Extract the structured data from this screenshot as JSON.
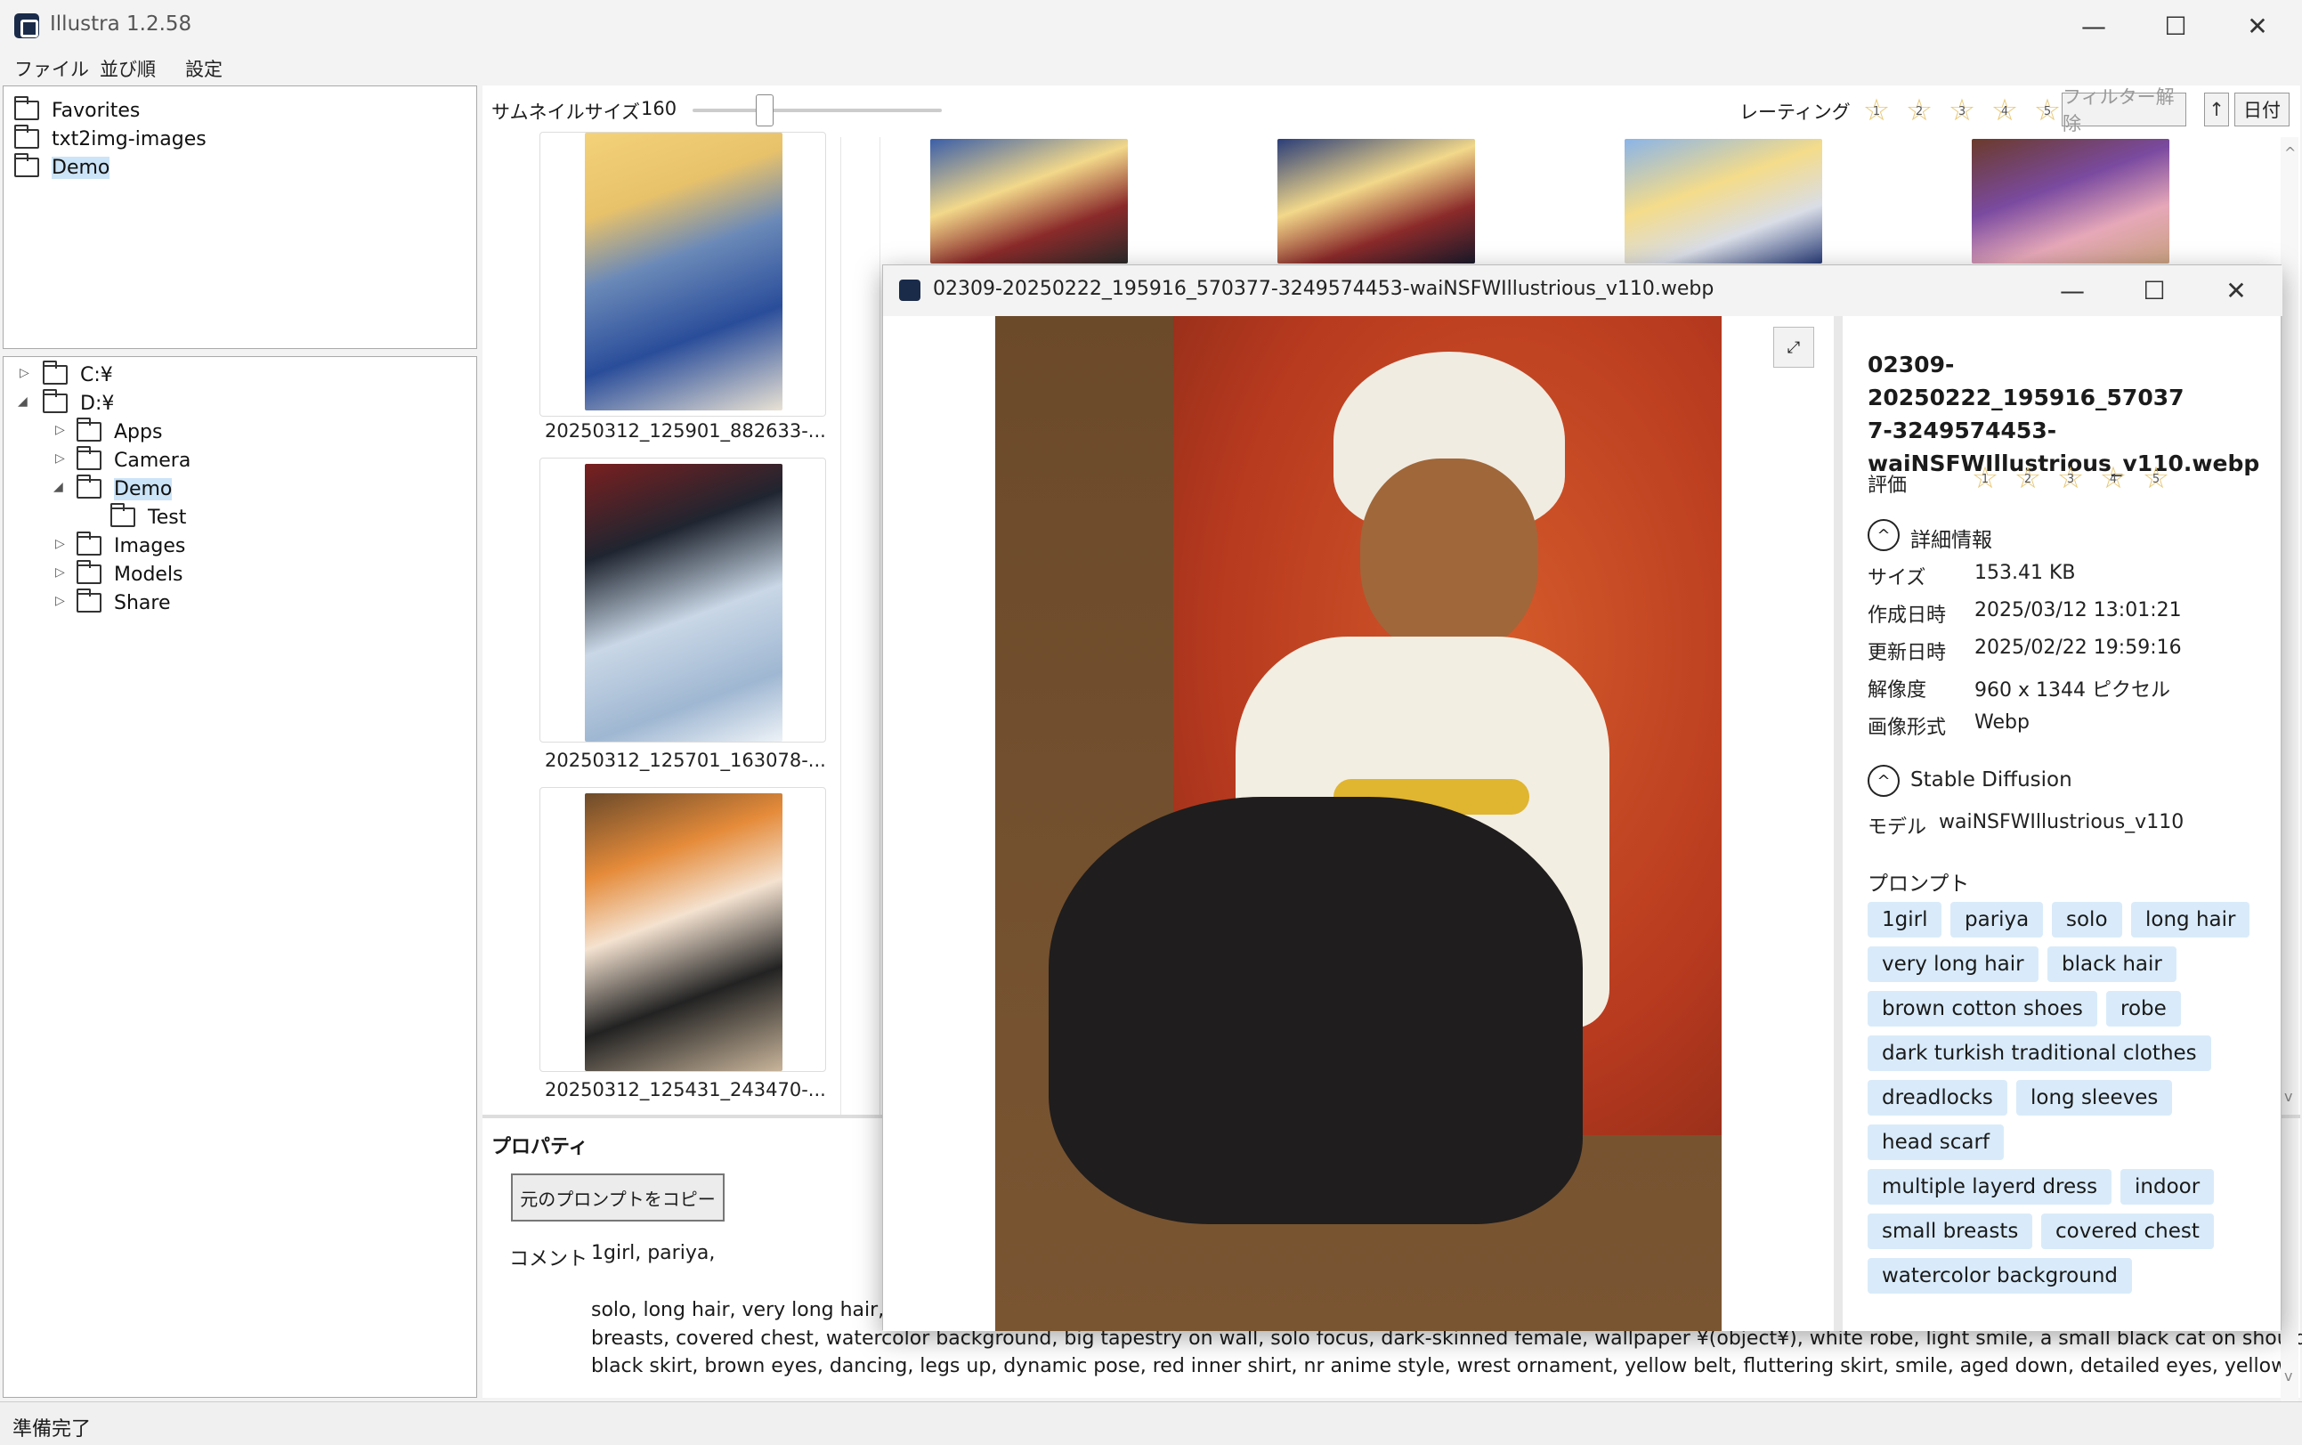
{
  "app": {
    "title": "Illustra 1.2.58"
  },
  "menu": [
    "ファイル",
    "並び順",
    "設定"
  ],
  "favorites": [
    "Favorites",
    "txt2img-images",
    "Demo"
  ],
  "tree": {
    "c": "C:¥",
    "d": "D:¥",
    "children": [
      "Apps",
      "Camera",
      "Demo",
      "Test",
      "Images",
      "Models",
      "Share"
    ]
  },
  "toolbar": {
    "thumb_label": "サムネイルサイズ",
    "thumb_value": "160",
    "thumb_fraction": 0.29,
    "rating_label": "レーティング",
    "rating_stars": [
      "1",
      "2",
      "3",
      "4",
      "5"
    ],
    "filter_clear": "フィルター解除",
    "sort_dir": "↑",
    "sort_key": "日付"
  },
  "thumbnails": [
    {
      "caption": "20250312_125901_882633-..."
    },
    {
      "caption": "20250312_125701_163078-..."
    },
    {
      "caption": "20250312_125431_243470-..."
    }
  ],
  "properties": {
    "header": "プロパティ",
    "copy_button": "元のプロンプトをコピー",
    "comment_label": "コメント",
    "comment_line1": "1girl, pariya,",
    "line2": "solo, long hair, very long hair, b",
    "line3": "breasts, covered chest, watercolor background, big tapestry on wall, solo focus, dark-skinned female, wallpaper ¥(object¥), white robe, light smile, a small black cat on shoulder,",
    "line4": "black skirt, brown eyes, dancing, legs up, dynamic pose, red inner shirt, nr anime style, wrest ornament, yellow belt, fluttering skirt, smile, aged down, detailed eyes, yellow"
  },
  "status": "準備完了",
  "viewer": {
    "window_title": "02309-20250222_195916_570377-3249574453-waiNSFWIllustrious_v110.webp",
    "file_name": "02309-20250222_195916_570377-3249574453-waiNSFWIllustrious_v110.webp",
    "file_name_lines": [
      "02309-20250222_195916_57037",
      "7-3249574453-",
      "waiNSFWIllustrious_v110.webp"
    ],
    "rating_label": "評価",
    "rating_stars": [
      "1",
      "2",
      "3",
      "4",
      "5"
    ],
    "details_header": "詳細情報",
    "details": [
      {
        "label": "サイズ",
        "value": "153.41 KB"
      },
      {
        "label": "作成日時",
        "value": "2025/03/12 13:01:21"
      },
      {
        "label": "更新日時",
        "value": "2025/02/22 19:59:16"
      },
      {
        "label": "解像度",
        "value": "960 x 1344 ピクセル"
      },
      {
        "label": "画像形式",
        "value": "Webp"
      }
    ],
    "sd_header": "Stable Diffusion",
    "model_label": "モデル",
    "model_value": "waiNSFWIllustrious_v110",
    "prompt_header": "プロンプト",
    "tags": [
      "1girl",
      "pariya",
      "solo",
      "long hair",
      "very long hair",
      "black hair",
      "brown cotton shoes",
      "robe",
      "dark turkish traditional clothes",
      "dreadlocks",
      "long sleeves",
      "head scarf",
      "multiple layerd dress",
      "indoor",
      "small breasts",
      "covered chest",
      "watercolor background"
    ]
  }
}
